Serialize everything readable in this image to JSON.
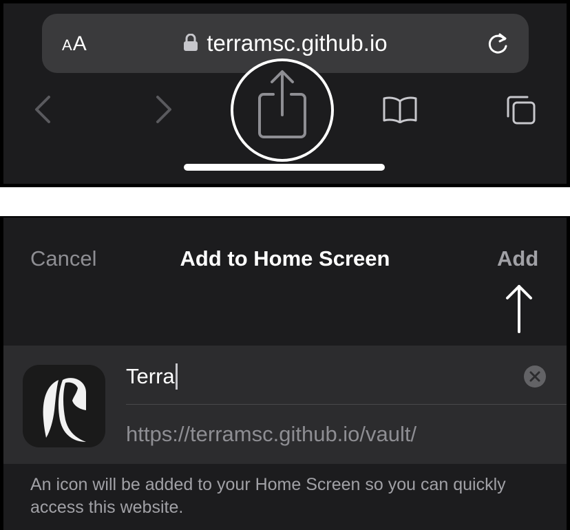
{
  "safari": {
    "aa_small": "A",
    "aa_large": "A",
    "url": "terramsc.github.io",
    "icons": {
      "lock": "lock-icon",
      "reload": "reload-icon",
      "back": "chevron-left-icon",
      "forward": "chevron-right-icon",
      "share": "share-icon",
      "bookmarks": "book-icon",
      "tabs": "tabs-icon"
    }
  },
  "sheet": {
    "cancel_label": "Cancel",
    "title": "Add to Home Screen",
    "add_label": "Add",
    "name_value": "Terra",
    "url_value": "https://terramsc.github.io/vault/",
    "footer": "An icon will be added to your Home Screen so you can quickly access this website.",
    "icons": {
      "pointer_arrow": "up-arrow-icon",
      "clear": "clear-icon",
      "app": "terra-logo-icon"
    }
  },
  "colors": {
    "background": "#1c1c1e",
    "card": "#2c2c2e",
    "address_bar": "#3a3a3c",
    "primary_text": "#ffffff",
    "secondary_text": "#8e8e93"
  }
}
